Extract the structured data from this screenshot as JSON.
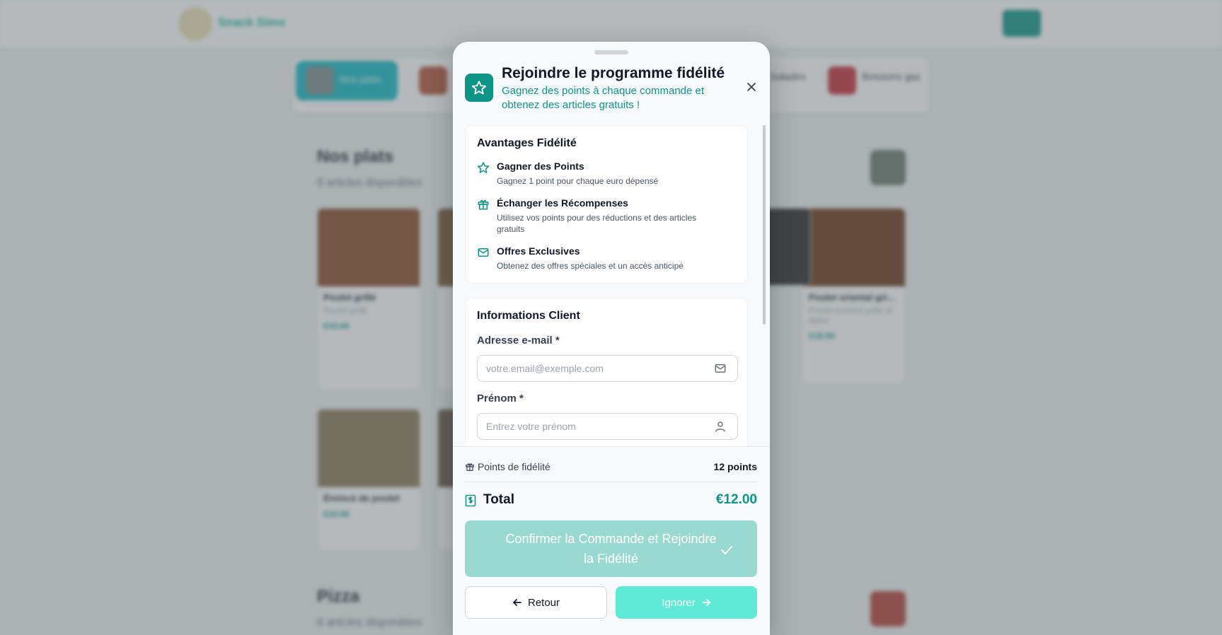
{
  "background": {
    "brand": "Snack Sims",
    "categories": [
      {
        "label": "Nos plats"
      },
      {
        "label": "Boissons gaz"
      },
      {
        "label": "Salades"
      }
    ],
    "sections": [
      {
        "title": "Nos plats",
        "subtitle": "8 articles disponibles"
      },
      {
        "title": "Pizza",
        "subtitle": "8 articles disponibles"
      }
    ],
    "items": [
      {
        "name": "Poulet grillé",
        "desc": "Poulet grillé",
        "price": "€10.00"
      },
      {
        "name": "Poulet oriental gri...",
        "desc": "Poulet oriental grillé et épicé",
        "price": "€18.00"
      },
      {
        "name": "Émincé de poulet",
        "desc": "",
        "price": "€10.00"
      }
    ]
  },
  "modal": {
    "title": "Rejoindre le programme fidélité",
    "subtitle": "Gagnez des points à chaque commande et obtenez des articles gratuits !",
    "benefits": {
      "title": "Avantages Fidélité",
      "items": [
        {
          "icon": "star-icon",
          "title": "Gagner des Points",
          "desc": "Gagnez 1 point pour chaque euro dépensé"
        },
        {
          "icon": "gift-icon",
          "title": "Échanger les Récompenses",
          "desc": "Utilisez vos points pour des réductions et des articles gratuits"
        },
        {
          "icon": "mail-icon",
          "title": "Offres Exclusives",
          "desc": "Obtenez des offres spéciales et un accès anticipé"
        }
      ]
    },
    "client_info": {
      "title": "Informations Client",
      "email_label": "Adresse e-mail *",
      "email_placeholder": "votre.email@exemple.com",
      "email_value": "",
      "firstname_label": "Prénom *",
      "firstname_placeholder": "Entrez votre prénom",
      "firstname_value": ""
    },
    "summary": {
      "points_label": "Points de fidélité",
      "points_value": "12 points",
      "total_label": "Total",
      "total_value": "€12.00"
    },
    "buttons": {
      "confirm": "Confirmer la Commande et Rejoindre la Fidélité",
      "back": "Retour",
      "skip": "Ignorer"
    }
  },
  "colors": {
    "accent": "#0f9488",
    "accent_light": "#5eead4",
    "confirm_disabled": "#9ad9d0"
  }
}
